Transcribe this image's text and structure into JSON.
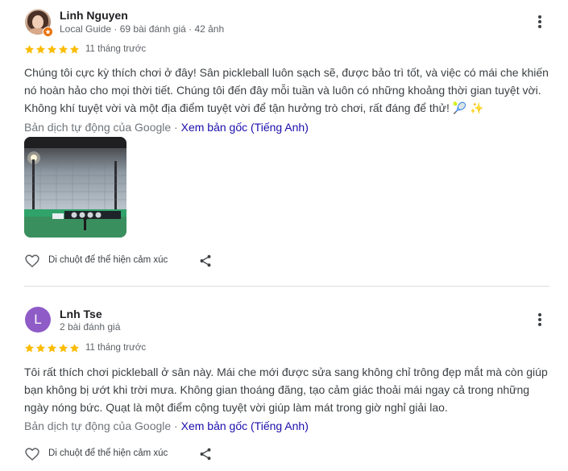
{
  "reviews": [
    {
      "author": "Linh Nguyen",
      "meta": "Local Guide · 69 bài đánh giá · 42 ảnh",
      "rating": 5,
      "time": "11 tháng trước",
      "text": "Chúng tôi cực kỳ thích chơi ở đây! Sân pickleball luôn sạch sẽ, được bảo trì tốt, và việc có mái che khiến nó hoàn hảo cho mọi thời tiết. Chúng tôi đến đây mỗi tuần và luôn có những khoảng thời gian tuyệt vời. Không khí tuyệt vời và một địa điểm tuyệt vời để tận hưởng trò chơi, rất đáng để thử! 🎾 ✨",
      "translation_label": "Bản dịch tự động của Google",
      "translation_sep": " · ",
      "original_link": "Xem bản gốc (Tiếng Anh)",
      "react_label": "Di chuột để thể hiện cảm xúc"
    },
    {
      "author": "Lnh Tse",
      "avatar_letter": "L",
      "meta": "2 bài đánh giá",
      "rating": 5,
      "time": "11 tháng trước",
      "text": "Tôi rất thích chơi pickleball ở sân này. Mái che mới được sửa sang không chỉ trông đẹp mắt mà còn giúp bạn không bị ướt khi trời mưa. Không gian thoáng đãng, tạo cảm giác thoải mái ngay cả trong những ngày nóng bức. Quạt là một điểm cộng tuyệt vời giúp làm mát trong giờ nghỉ giải lao.",
      "translation_label": "Bản dịch tự động của Google",
      "translation_sep": " · ",
      "original_link": "Xem bản gốc (Tiếng Anh)",
      "react_label": "Di chuột để thể hiện cảm xúc"
    }
  ],
  "colors": {
    "star": "#fbbc04",
    "link": "#1a0dab",
    "avatar2": "#8e5bc7",
    "guide_badge": "#e8710a"
  },
  "icons": [
    "more-vert-icon",
    "star-icon",
    "heart-outline-icon",
    "share-icon",
    "local-guide-badge-icon"
  ]
}
